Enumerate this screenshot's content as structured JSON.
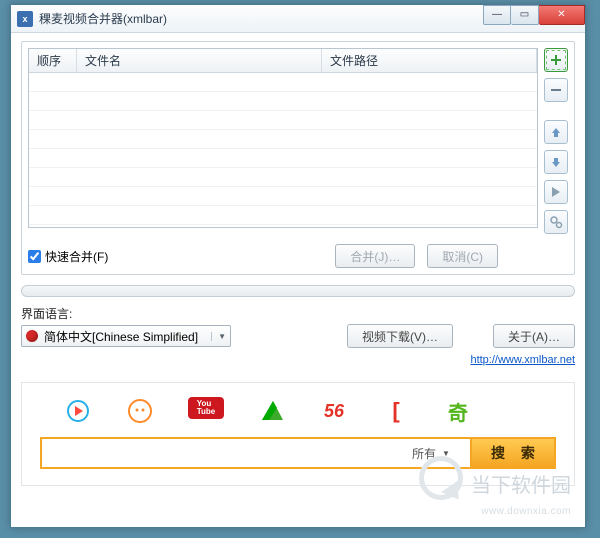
{
  "window": {
    "title": "稞麦视频合并器(xmlbar)"
  },
  "grid": {
    "columns": {
      "order": "顺序",
      "name": "文件名",
      "path": "文件路径"
    }
  },
  "tools": {
    "add": "add",
    "remove": "remove",
    "up": "move-up",
    "down": "move-down",
    "play": "play",
    "settings": "settings"
  },
  "actions": {
    "fast_merge_label": "快速合并(F)",
    "fast_merge_checked": true,
    "merge_btn": "合并(J)…",
    "cancel_btn": "取消(C)"
  },
  "language": {
    "label": "界面语言:",
    "selected": "简体中文[Chinese Simplified]"
  },
  "right_buttons": {
    "download": "视频下载(V)…",
    "about": "关于(A)…"
  },
  "link": {
    "text": "http://www.xmlbar.net"
  },
  "sites": [
    "youku",
    "tudou",
    "youtube",
    "iqiyi-green",
    "56",
    "letv",
    "qiyi"
  ],
  "search": {
    "placeholder": "",
    "filter": "所有",
    "button": "搜 索"
  },
  "watermark": {
    "text": "当下软件园",
    "url": "www.downxia.com"
  },
  "colors": {
    "accent": "#f5a623"
  }
}
